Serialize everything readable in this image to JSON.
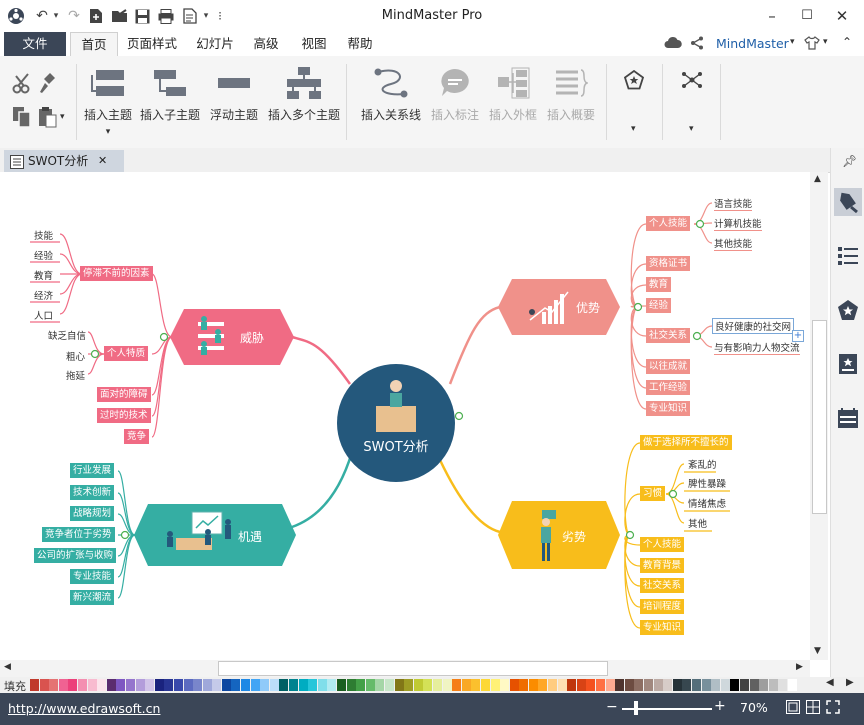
{
  "window": {
    "title": "MindMaster Pro",
    "minimize": "–",
    "maximize": "☐",
    "close": "✕"
  },
  "menu": {
    "file": "文件",
    "tabs": [
      "首页",
      "页面样式",
      "幻灯片",
      "高级",
      "视图",
      "帮助"
    ],
    "account": "MindMaster"
  },
  "ribbon": {
    "insert_topic": "插入主题",
    "insert_subtopic": "插入子主题",
    "floating_topic": "浮动主题",
    "insert_multiple": "插入多个主题",
    "insert_relation": "插入关系线",
    "insert_callout": "插入标注",
    "insert_boundary": "插入外框",
    "insert_summary": "插入概要"
  },
  "doc_tab": {
    "title": "SWOT分析",
    "close": "✕"
  },
  "mindmap": {
    "center": "SWOT分析",
    "threat": {
      "title": "威胁",
      "items": [
        "停滞不前的因素",
        "个人特质",
        "面对的障碍",
        "过时的技术",
        "竞争"
      ],
      "stagnation_children": [
        "技能",
        "经验",
        "教育",
        "经济",
        "人口"
      ],
      "trait_children": [
        "缺乏自信",
        "粗心",
        "拖延"
      ]
    },
    "strength": {
      "title": "优势",
      "items": [
        "个人技能",
        "资格证书",
        "教育",
        "经验",
        "社交关系",
        "以往成就",
        "工作经验",
        "专业知识"
      ],
      "skill_children": [
        "语言技能",
        "计算机技能",
        "其他技能"
      ],
      "social_children": [
        "良好健康的社交网",
        "与有影响力人物交流"
      ]
    },
    "opportunity": {
      "title": "机遇",
      "items": [
        "行业发展",
        "技术创新",
        "战略规划",
        "竞争者位于劣势",
        "公司的扩张与收购",
        "专业技能",
        "新兴潮流"
      ]
    },
    "weakness": {
      "title": "劣势",
      "items": [
        "做于选择所不擅长的",
        "习惯",
        "个人技能",
        "教育背景",
        "社交关系",
        "培训程度",
        "专业知识"
      ],
      "habit_children": [
        "紊乱的",
        "脾性暴躁",
        "情绪焦虑",
        "其他"
      ]
    }
  },
  "colors": {
    "threat": "#f06b84",
    "strength": "#f0918a",
    "opportunity": "#35aea3",
    "weakness": "#f8bd1b",
    "center": "#24587c",
    "palette": [
      "#c0392b",
      "#d9534f",
      "#e57373",
      "#f06292",
      "#ec407a",
      "#f48fb1",
      "#f8bbd0",
      "#fce4ec",
      "#5b2c6f",
      "#7e57c2",
      "#9575cd",
      "#b39ddb",
      "#d1c4e9",
      "#1a237e",
      "#283593",
      "#3949ab",
      "#5c6bc0",
      "#7986cb",
      "#9fa8da",
      "#c5cae9",
      "#0d47a1",
      "#1565c0",
      "#1e88e5",
      "#42a5f5",
      "#90caf9",
      "#bbdefb",
      "#006064",
      "#00838f",
      "#00acc1",
      "#26c6da",
      "#80deea",
      "#b2ebf2",
      "#1b5e20",
      "#2e7d32",
      "#43a047",
      "#66bb6a",
      "#a5d6a7",
      "#c8e6c9",
      "#827717",
      "#9e9d24",
      "#c0ca33",
      "#d4e157",
      "#e6ee9c",
      "#f0f4c3",
      "#f57f17",
      "#f9a825",
      "#fbc02d",
      "#fdd835",
      "#fff176",
      "#fff9c4",
      "#e65100",
      "#ef6c00",
      "#fb8c00",
      "#ffa726",
      "#ffcc80",
      "#ffe0b2",
      "#bf360c",
      "#d84315",
      "#f4511e",
      "#ff7043",
      "#ffab91",
      "#4e342e",
      "#6d4c41",
      "#8d6e63",
      "#a1887f",
      "#bcaaa4",
      "#d7ccc8",
      "#263238",
      "#37474f",
      "#546e7a",
      "#78909c",
      "#b0bec5",
      "#cfd8dc",
      "#000000",
      "#424242",
      "#616161",
      "#9e9e9e",
      "#bdbdbd",
      "#e0e0e0",
      "#ffffff"
    ]
  },
  "status": {
    "fill_label": "填充",
    "url": "http://www.edrawsoft.cn",
    "zoom": "70%"
  }
}
